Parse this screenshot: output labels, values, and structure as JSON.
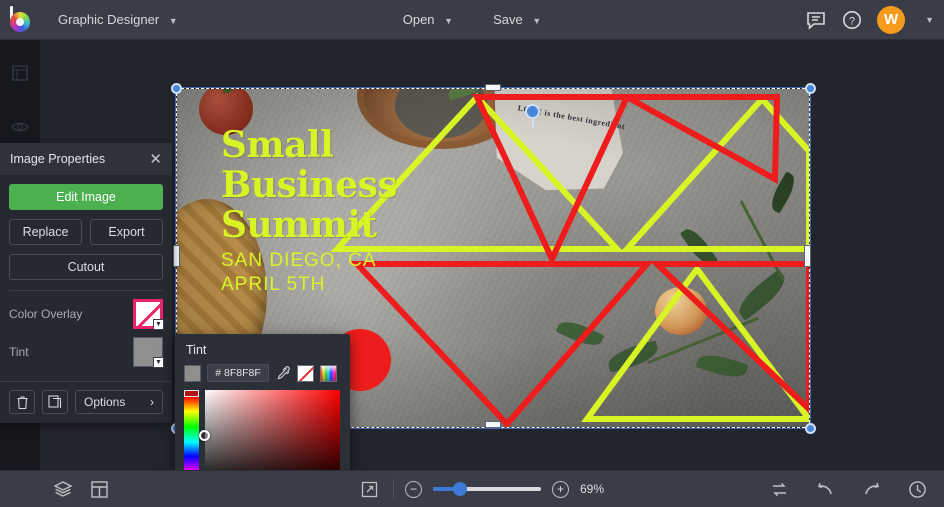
{
  "topbar": {
    "logo_name": "bevy-logo",
    "document_title": "Graphic Designer",
    "menus": [
      {
        "label": "Open",
        "name": "open-menu"
      },
      {
        "label": "Save",
        "name": "save-menu"
      }
    ],
    "comments_icon": "comment-icon",
    "help_icon": "help-icon",
    "avatar_initial": "W",
    "avatar_color": "#f59b1e"
  },
  "left_rail": {
    "items": [
      {
        "name": "templates-icon"
      },
      {
        "name": "effects-icon"
      },
      {
        "name": "layout-icon"
      }
    ]
  },
  "panel": {
    "title": "Image Properties",
    "close_label": "✕",
    "edit_image": "Edit Image",
    "replace": "Replace",
    "export": "Export",
    "cutout": "Cutout",
    "color_overlay_label": "Color Overlay",
    "tint_label": "Tint",
    "color_overlay_value": "none",
    "tint_value": "#8F8F8F",
    "delete_icon": "trash-icon",
    "duplicate_icon": "duplicate-icon",
    "options_label": "Options",
    "options_chevron": "›"
  },
  "tint_popover": {
    "title": "Tint",
    "hex_value": "# 8F8F8F",
    "eyedropper_icon": "eyedropper-icon",
    "no_color_icon": "no-color-swatch",
    "rainbow_icon": "rainbow-swatch",
    "swatch_color": "#8F8F8F",
    "picker_hue": "red"
  },
  "canvas": {
    "poster": {
      "title_lines": [
        "Small",
        "Business",
        "Summit"
      ],
      "subtitle_lines": [
        "SAN DIEGO, CA",
        "APRIL 5TH"
      ],
      "text_color": "#d9f425",
      "accent_yellow": "#d9f425",
      "accent_red": "#ee1c1c",
      "paper_text": "LOVE is the best ingredient"
    },
    "selection": {
      "handle_color": "#4a86d8",
      "rotate_handle": "rotation-handle"
    }
  },
  "bottombar": {
    "layers_icon": "layers-icon",
    "grid_icon": "grid-icon",
    "fit_icon": "fit-to-screen-icon",
    "zoom_out": "−",
    "zoom_in": "+",
    "zoom_value": "69%",
    "zoom_percent": 69,
    "swap_icon": "swap-icon",
    "undo_icon": "undo-icon",
    "redo_icon": "redo-icon",
    "history_icon": "history-icon"
  }
}
